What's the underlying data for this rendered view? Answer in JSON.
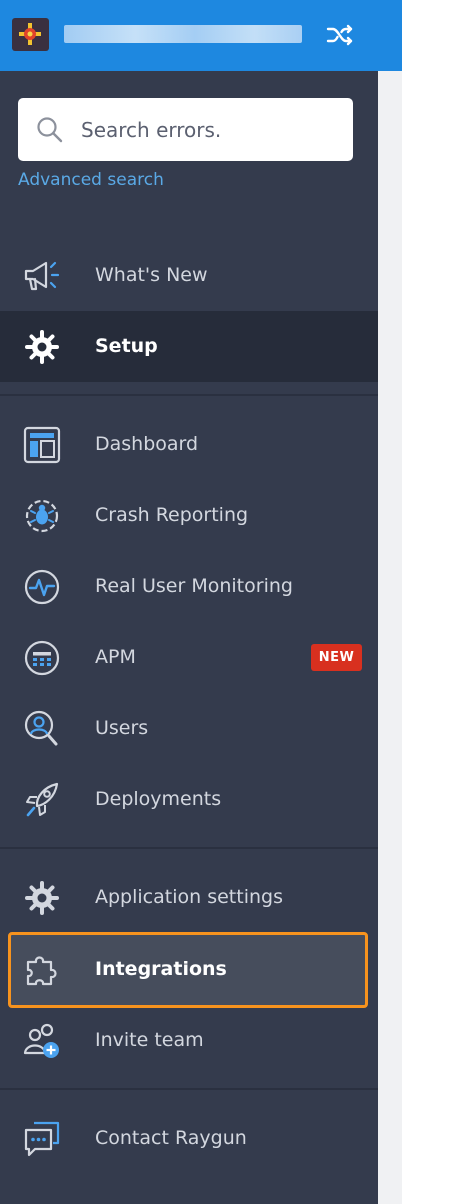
{
  "header": {
    "app_icon": "raygun-app-icon",
    "app_name": "",
    "switch_icon": "shuffle-icon"
  },
  "search": {
    "placeholder": "Search errors.",
    "value": "",
    "advanced_link": "Advanced search"
  },
  "nav": {
    "whats_new": "What's New",
    "setup": "Setup",
    "dashboard": "Dashboard",
    "crash_reporting": "Crash Reporting",
    "rum": "Real User Monitoring",
    "apm": "APM",
    "apm_badge": "NEW",
    "users": "Users",
    "deployments": "Deployments",
    "app_settings": "Application settings",
    "integrations": "Integrations",
    "invite_team": "Invite team",
    "contact": "Contact Raygun"
  },
  "colors": {
    "topbar": "#1e88e0",
    "sidebar": "#343b4d",
    "active_item": "#262c3a",
    "icon_blue": "#4ba3f0",
    "badge": "#d8301f",
    "highlight_border": "#f7931e"
  }
}
